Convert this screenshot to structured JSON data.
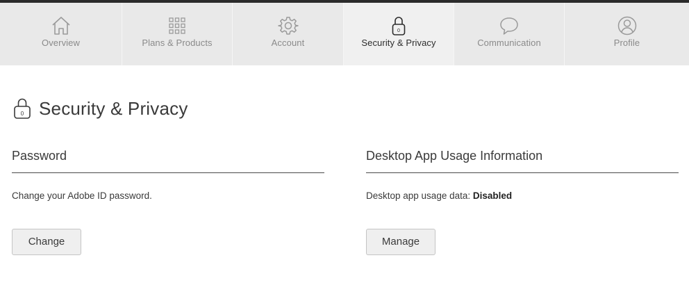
{
  "nav": {
    "tabs": [
      {
        "key": "overview",
        "label": "Overview",
        "icon": "home-icon",
        "active": false
      },
      {
        "key": "plans",
        "label": "Plans & Products",
        "icon": "grid-icon",
        "active": false
      },
      {
        "key": "account",
        "label": "Account",
        "icon": "gear-icon",
        "active": false
      },
      {
        "key": "security",
        "label": "Security & Privacy",
        "icon": "lock-icon",
        "active": true
      },
      {
        "key": "communication",
        "label": "Communication",
        "icon": "speech-bubble-icon",
        "active": false
      },
      {
        "key": "profile",
        "label": "Profile",
        "icon": "user-circle-icon",
        "active": false
      }
    ]
  },
  "page": {
    "title": "Security & Privacy",
    "title_icon": "lock-icon"
  },
  "password": {
    "heading": "Password",
    "description": "Change your Adobe ID password.",
    "button_label": "Change"
  },
  "desktop_usage": {
    "heading": "Desktop App Usage Information",
    "description_prefix": "Desktop app usage data: ",
    "status": "Disabled",
    "button_label": "Manage"
  },
  "colors": {
    "nav_background": "#e9e9e9",
    "top_border": "#2b2b2b",
    "inactive_label": "#8a8a8a",
    "active_label": "#2c2c2c",
    "button_background": "#efefef"
  }
}
